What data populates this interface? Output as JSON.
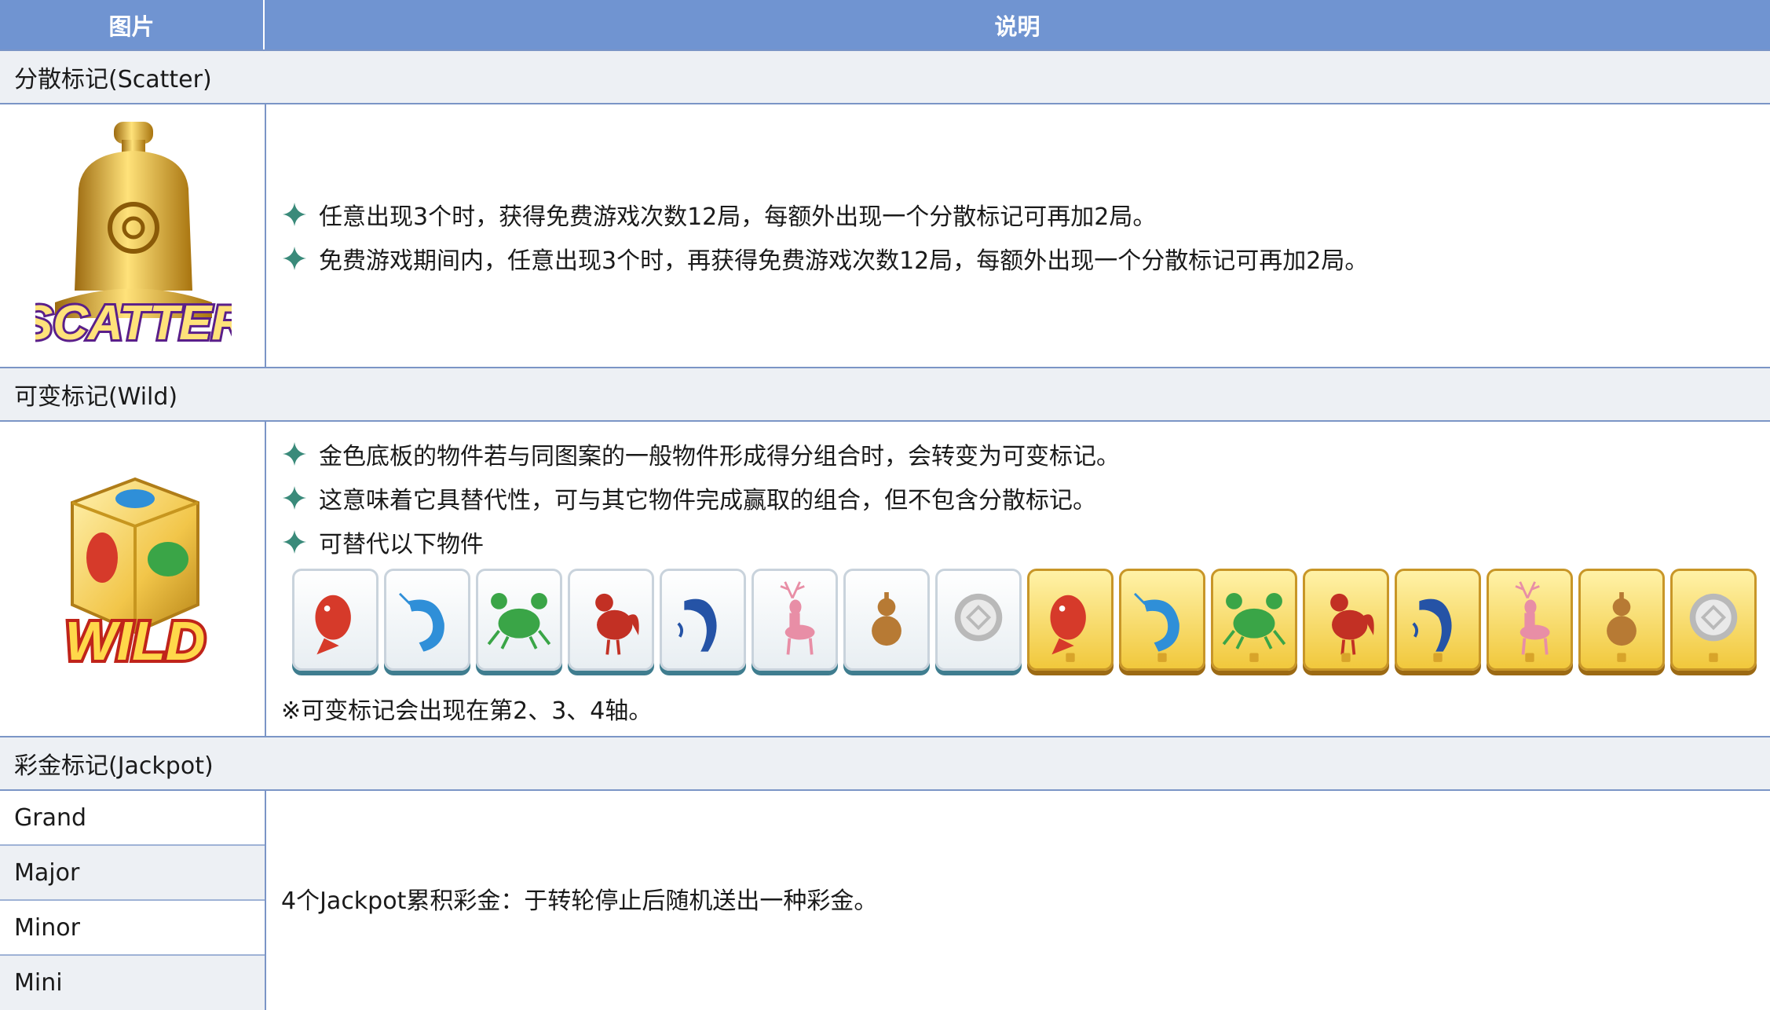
{
  "header": {
    "col_image": "图片",
    "col_desc": "说明"
  },
  "scatter": {
    "title": "分散标记(Scatter)",
    "icon_label": "SCATTER",
    "lines": [
      "任意出现3个时，获得免费游戏次数12局，每额外出现一个分散标记可再加2局。",
      "免费游戏期间内，任意出现3个时，再获得免费游戏次数12局，每额外出现一个分散标记可再加2局。"
    ]
  },
  "wild": {
    "title": "可变标记(Wild)",
    "icon_label": "WILD",
    "lines": [
      "金色底板的物件若与同图案的一般物件形成得分组合时，会转变为可变标记。",
      "这意味着它具替代性，可与其它物件完成赢取的组合，但不包含分散标记。",
      "可替代以下物件"
    ],
    "tiles": [
      {
        "icon": "fish-icon",
        "style": "white",
        "color": "#d63a2a"
      },
      {
        "icon": "shrimp-icon",
        "style": "white",
        "color": "#2f8fd8"
      },
      {
        "icon": "crab-icon",
        "style": "white",
        "color": "#3aa547"
      },
      {
        "icon": "rooster-icon",
        "style": "white",
        "color": "#c23024"
      },
      {
        "icon": "tiger-icon",
        "style": "white",
        "color": "#2553a6"
      },
      {
        "icon": "deer-icon",
        "style": "white",
        "color": "#e88ea6"
      },
      {
        "icon": "gourd-icon",
        "style": "white",
        "color": "#b77a34"
      },
      {
        "icon": "coin-icon",
        "style": "white",
        "color": "#b9b9b9"
      },
      {
        "icon": "fish-icon",
        "style": "gold",
        "color": "#d63a2a"
      },
      {
        "icon": "shrimp-icon",
        "style": "gold",
        "color": "#2f8fd8"
      },
      {
        "icon": "crab-icon",
        "style": "gold",
        "color": "#3aa547"
      },
      {
        "icon": "rooster-icon",
        "style": "gold",
        "color": "#c23024"
      },
      {
        "icon": "tiger-icon",
        "style": "gold",
        "color": "#2553a6"
      },
      {
        "icon": "deer-icon",
        "style": "gold",
        "color": "#e88ea6"
      },
      {
        "icon": "gourd-icon",
        "style": "gold",
        "color": "#b77a34"
      },
      {
        "icon": "coin-icon",
        "style": "gold",
        "color": "#b9b9b9"
      }
    ],
    "note": "※可变标记会出现在第2、3、4轴。"
  },
  "jackpot": {
    "title": "彩金标记(Jackpot)",
    "levels": [
      "Grand",
      "Major",
      "Minor",
      "Mini"
    ],
    "desc": "4个Jackpot累积彩金：于转轮停止后随机送出一种彩金。"
  },
  "colors": {
    "header_bg": "#7094d1",
    "section_bg": "#edf0f4",
    "border": "#7b95c6",
    "star": "#3a8a7a"
  }
}
